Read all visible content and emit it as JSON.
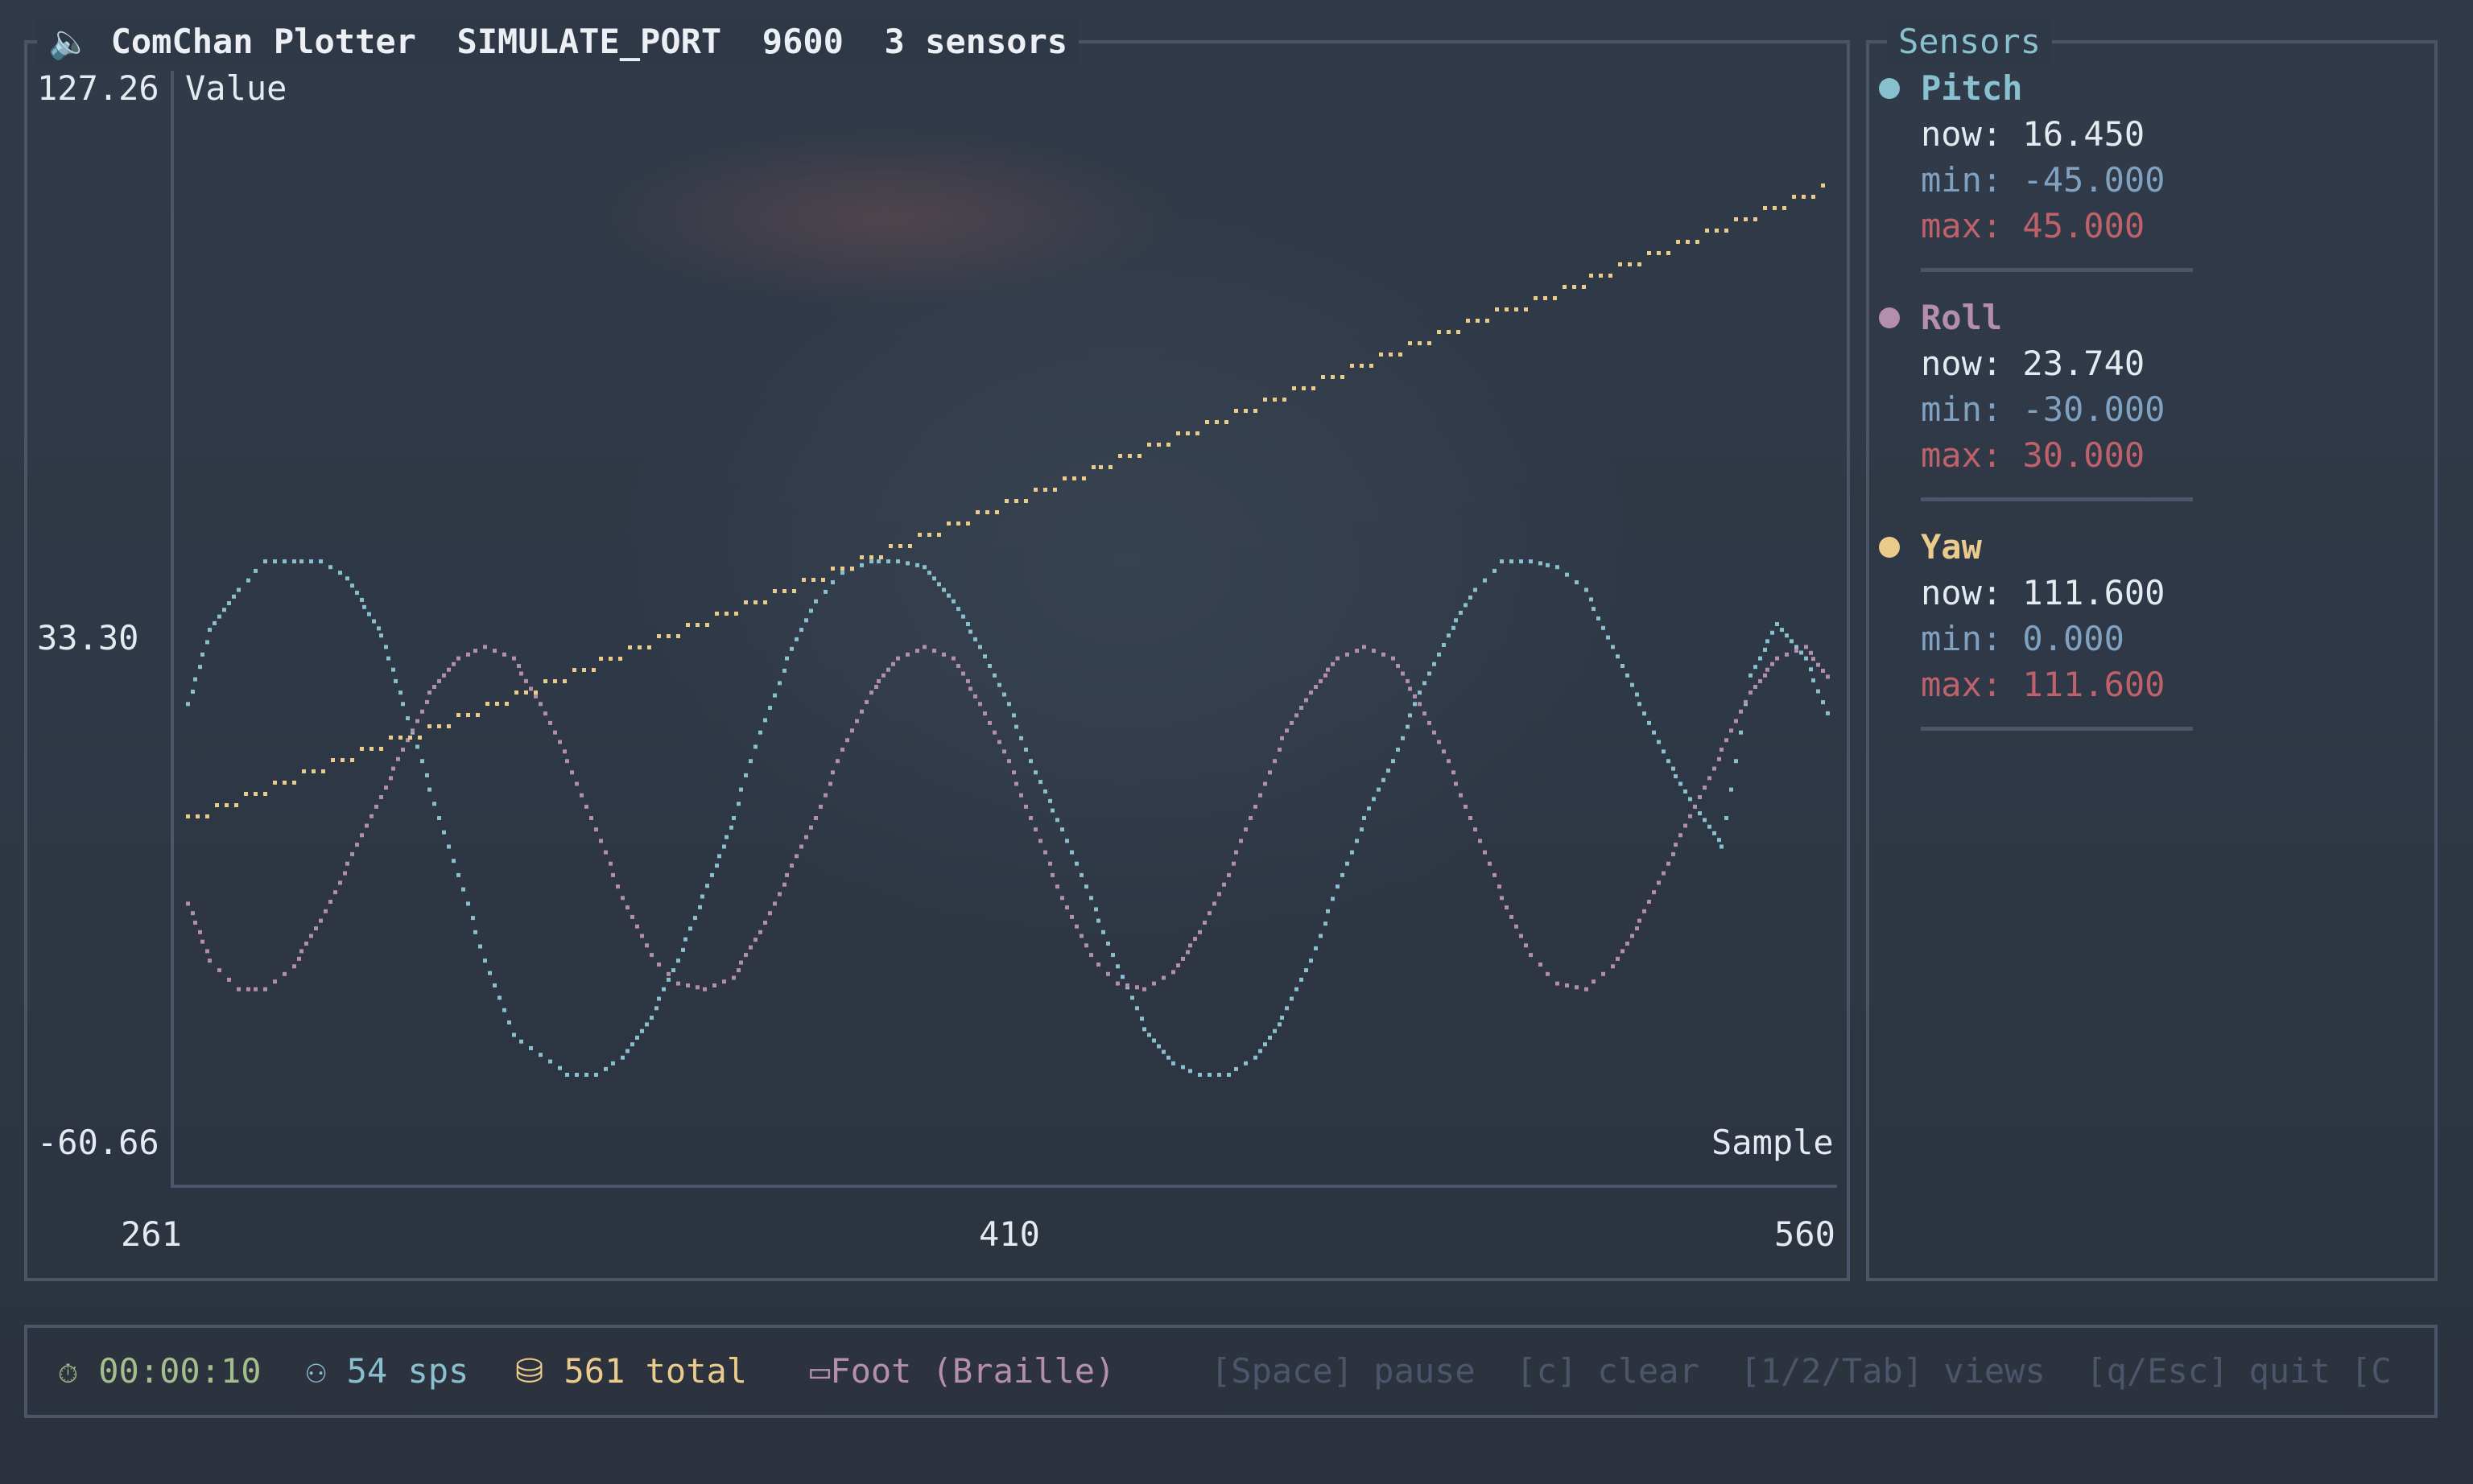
{
  "header": {
    "app_name": "ComChan Plotter",
    "port": "SIMULATE_PORT",
    "baud": "9600",
    "sensor_count": "3 sensors",
    "speaker_icon": "speaker-icon"
  },
  "plot": {
    "y_label": "Value",
    "x_label": "Sample"
  },
  "chart_data": {
    "type": "line",
    "xlabel": "Sample",
    "ylabel": "Value",
    "xlim": [
      261,
      560
    ],
    "ylim": [
      -60.66,
      127.26
    ],
    "y_ticks": [
      "127.26",
      "33.30",
      "-60.66"
    ],
    "x_ticks": [
      "261",
      "410",
      "560"
    ],
    "series": [
      {
        "name": "Pitch",
        "color": "#88c0d0",
        "x": [
          261,
          265,
          270,
          275,
          280,
          285,
          290,
          296,
          300,
          305,
          310,
          315,
          320,
          330,
          335,
          340,
          345,
          350,
          356,
          360,
          365,
          370,
          375,
          380,
          385,
          390,
          395,
          400,
          405,
          410,
          415,
          420,
          425,
          430,
          435,
          440,
          445,
          450,
          455,
          460,
          465,
          470,
          475,
          480,
          485,
          490,
          495,
          500,
          505,
          510,
          515,
          520,
          525,
          530,
          535,
          540,
          545,
          550,
          555,
          560
        ],
        "y": [
          20,
          33,
          40,
          45,
          45,
          45,
          42,
          32,
          20,
          5,
          -10,
          -25,
          -38,
          -45,
          -45,
          -42,
          -35,
          -25,
          -10,
          0,
          15,
          28,
          38,
          43,
          45,
          45,
          44,
          38,
          30,
          20,
          8,
          -2,
          -14,
          -26,
          -37,
          -43,
          -45,
          -45,
          -42,
          -35,
          -25,
          -12,
          0,
          10,
          22,
          32,
          40,
          45,
          45,
          44,
          40,
          30,
          20,
          10,
          2,
          -5,
          25,
          34,
          28,
          16.45
        ]
      },
      {
        "name": "Roll",
        "color": "#b48ead",
        "x": [
          261,
          265,
          270,
          275,
          280,
          285,
          290,
          295,
          300,
          305,
          310,
          315,
          320,
          325,
          330,
          335,
          340,
          345,
          350,
          355,
          360,
          365,
          370,
          375,
          380,
          385,
          390,
          395,
          400,
          405,
          410,
          415,
          420,
          425,
          430,
          435,
          440,
          445,
          450,
          455,
          460,
          465,
          470,
          475,
          480,
          485,
          490,
          495,
          500,
          505,
          510,
          515,
          520,
          525,
          530,
          535,
          540,
          545,
          550,
          555,
          560
        ],
        "y": [
          -15,
          -25,
          -30,
          -30,
          -26,
          -18,
          -8,
          2,
          12,
          22,
          28,
          30,
          28,
          20,
          10,
          -2,
          -14,
          -24,
          -29,
          -30,
          -28,
          -20,
          -10,
          0,
          12,
          22,
          28,
          30,
          28,
          20,
          10,
          -2,
          -14,
          -24,
          -29,
          -30,
          -27,
          -20,
          -10,
          2,
          14,
          22,
          28,
          30,
          28,
          20,
          10,
          -2,
          -14,
          -24,
          -29,
          -30,
          -26,
          -18,
          -8,
          2,
          12,
          22,
          28,
          30,
          23.74
        ]
      },
      {
        "name": "Yaw",
        "color": "#ebcb8b",
        "x": [
          261,
          560
        ],
        "y": [
          0,
          111.6
        ]
      }
    ]
  },
  "sensors": {
    "title": "Sensors",
    "items": [
      {
        "name": "Pitch",
        "color": "#88c0d0",
        "now": "now: 16.450",
        "min": "min: -45.000",
        "max": "max: 45.000"
      },
      {
        "name": "Roll",
        "color": "#b48ead",
        "now": "now: 23.740",
        "min": "min: -30.000",
        "max": "max: 30.000"
      },
      {
        "name": "Yaw",
        "color": "#ebcb8b",
        "now": "now: 111.600",
        "min": "min: 0.000",
        "max": "max: 111.600"
      }
    ]
  },
  "status": {
    "elapsed": "00:00:10",
    "rate": "54 sps",
    "total": "561 total",
    "view": "Foot (Braille)",
    "hints": "[Space] pause  [c] clear  [1/2/Tab] views  [q/Esc] quit [C",
    "timer_icon": "stopwatch-icon",
    "rate_icon": "people-icon",
    "total_icon": "database-icon",
    "view_icon": "monitor-icon"
  },
  "colors": {
    "border": "#4a5568",
    "text": "#e5e9f0",
    "accent": "#88c0d0",
    "min": "#81a1c1",
    "max": "#bf616a",
    "green": "#a3be8c",
    "yellow": "#ebcb8b",
    "purple": "#b48ead",
    "dim": "#4c566a"
  }
}
